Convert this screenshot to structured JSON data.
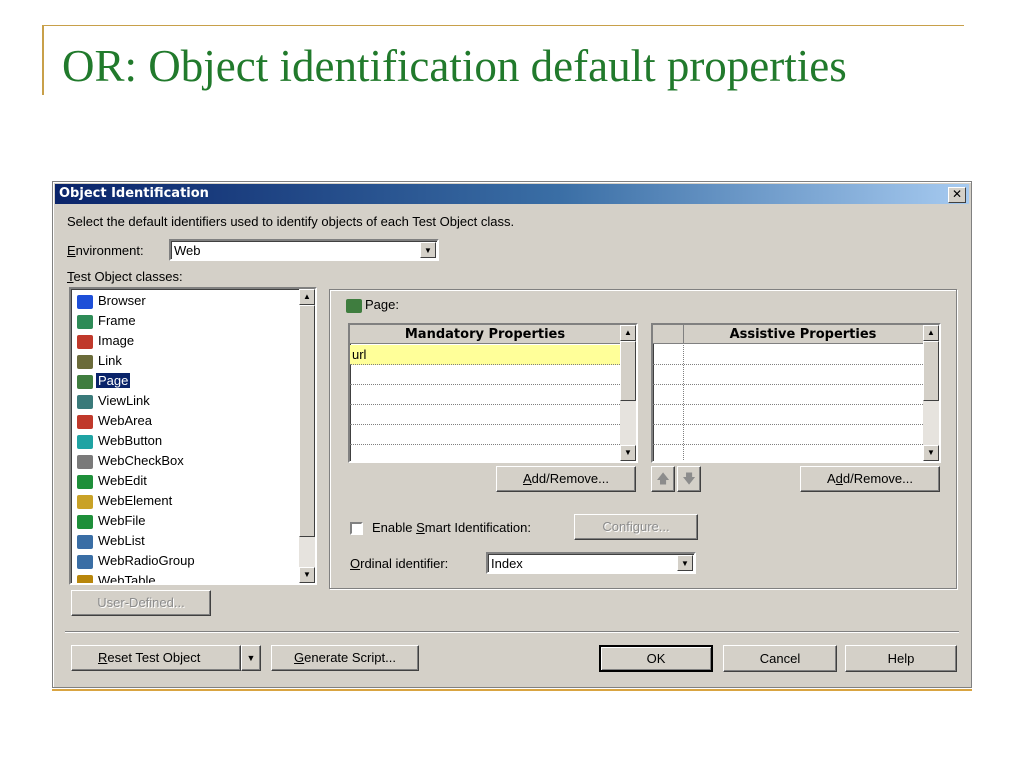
{
  "slide": {
    "title": "OR: Object identification default properties"
  },
  "dialog": {
    "title": "Object Identification",
    "description": "Select the default identifiers used to identify objects of each Test Object class.",
    "environment": {
      "label_prefix": "E",
      "label_rest": "nvironment:",
      "value": "Web"
    },
    "classes": {
      "label_prefix": "T",
      "label_rest": "est Object classes:",
      "items": [
        {
          "label": "Browser",
          "icon": "browser-icon",
          "color": "#1e4fd8"
        },
        {
          "label": "Frame",
          "icon": "frame-icon",
          "color": "#2e8b57"
        },
        {
          "label": "Image",
          "icon": "image-icon",
          "color": "#c0392b"
        },
        {
          "label": "Link",
          "icon": "link-icon",
          "color": "#6b6b3a"
        },
        {
          "label": "Page",
          "icon": "page-icon",
          "color": "#3f7d3f",
          "selected": true
        },
        {
          "label": "ViewLink",
          "icon": "viewlink-icon",
          "color": "#3a7a7a"
        },
        {
          "label": "WebArea",
          "icon": "webarea-icon",
          "color": "#c0392b"
        },
        {
          "label": "WebButton",
          "icon": "webbutton-icon",
          "color": "#1fa3a3"
        },
        {
          "label": "WebCheckBox",
          "icon": "webcheckbox-icon",
          "color": "#7a7a7a"
        },
        {
          "label": "WebEdit",
          "icon": "webedit-icon",
          "color": "#1e8f3a"
        },
        {
          "label": "WebElement",
          "icon": "webelement-icon",
          "color": "#c9a227"
        },
        {
          "label": "WebFile",
          "icon": "webfile-icon",
          "color": "#1e8f3a"
        },
        {
          "label": "WebList",
          "icon": "weblist-icon",
          "color": "#3a6ea5"
        },
        {
          "label": "WebRadioGroup",
          "icon": "webradiogroup-icon",
          "color": "#3a6ea5"
        },
        {
          "label": "WebTable",
          "icon": "webtable-icon",
          "color": "#b8860b"
        }
      ],
      "user_defined_button": "User-Defined..."
    },
    "page_group": {
      "label": "Page:",
      "mandatory": {
        "header": "Mandatory Properties",
        "rows": [
          "url",
          "",
          "",
          "",
          "",
          ""
        ]
      },
      "assistive": {
        "header": "Assistive Properties",
        "rows": [
          "",
          "",
          "",
          "",
          "",
          ""
        ]
      },
      "add_remove_mandatory": {
        "pre": "",
        "u": "A",
        "post": "dd/Remove..."
      },
      "add_remove_assistive": {
        "pre": "A",
        "u": "d",
        "post": "d/Remove..."
      },
      "smart_id": {
        "label_pre": "Enable ",
        "label_u": "S",
        "label_post": "mart Identification:",
        "checked": false
      },
      "configure_button": "Configure...",
      "ordinal": {
        "label_u": "O",
        "label_post": "rdinal identifier:",
        "value": "Index"
      }
    },
    "footer": {
      "reset": {
        "u": "R",
        "post": "eset Test Object"
      },
      "generate": {
        "u": "G",
        "post": "enerate Script..."
      },
      "ok": "OK",
      "cancel": "Cancel",
      "help": "Help"
    },
    "colors": {
      "highlight_row": "#ffff99",
      "selection": "#0a246a"
    }
  }
}
